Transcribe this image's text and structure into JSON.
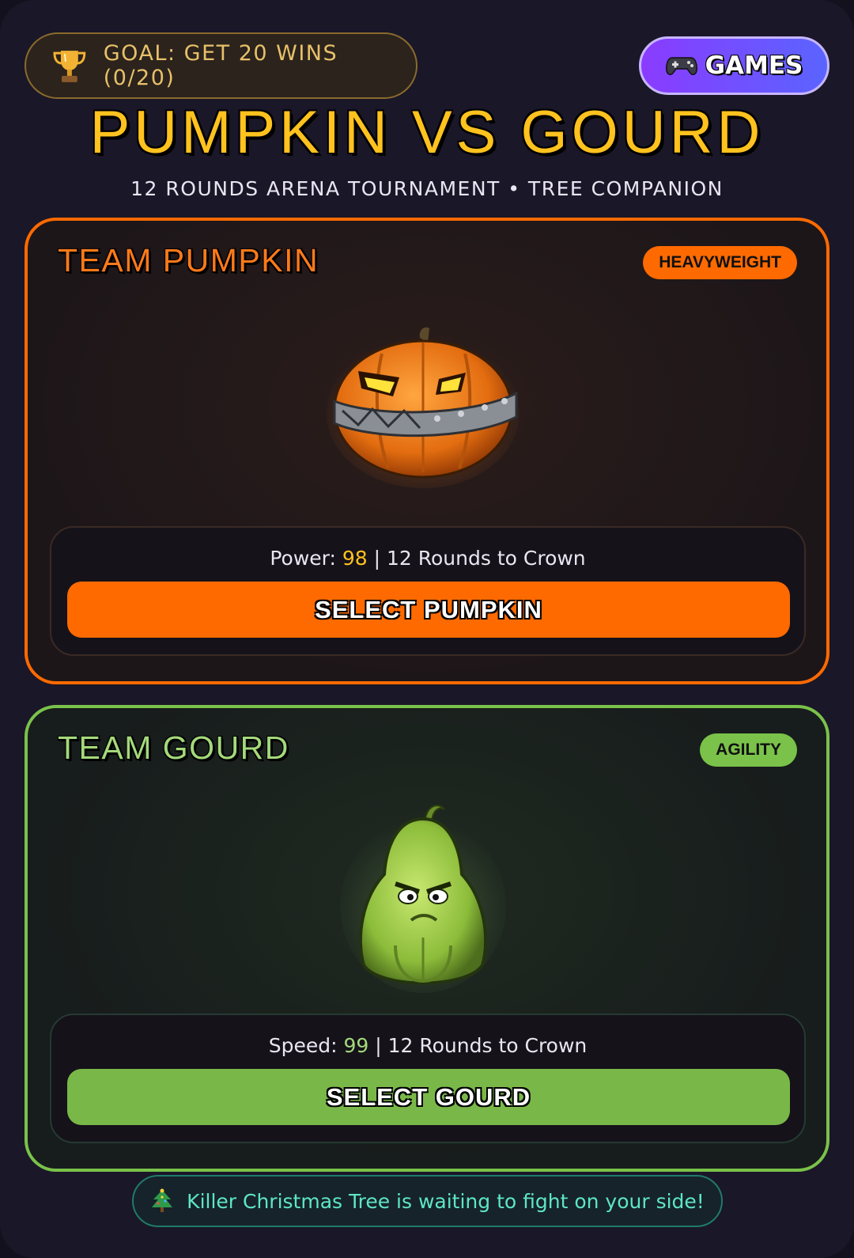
{
  "header": {
    "goal_text": "GOAL: GET 20 WINS (0/20)",
    "goal_icon": "trophy-icon",
    "games_label": "GAMES",
    "games_icon": "gamepad-icon",
    "title": "PUMPKIN VS GOURD",
    "subtitle": "12 ROUNDS ARENA TOURNAMENT • TREE COMPANION"
  },
  "teams": [
    {
      "name": "TEAM PUMPKIN",
      "badge": "HEAVYWEIGHT",
      "stat_label": "Power: ",
      "stat_value": "98",
      "stat_suffix": " | 12 Rounds to Crown",
      "button_label": "SELECT PUMPKIN",
      "accent": "#ff6a00"
    },
    {
      "name": "TEAM GOURD",
      "badge": "AGILITY",
      "stat_label": "Speed: ",
      "stat_value": "99",
      "stat_suffix": " | 12 Rounds to Crown",
      "button_label": "SELECT GOURD",
      "accent": "#7ac24a"
    }
  ],
  "footer": {
    "icon": "christmas-tree-icon",
    "text": "Killer Christmas Tree is waiting to fight on your side!"
  },
  "colors": {
    "background": "#1a1728",
    "title": "#ffc21e",
    "games_gradient": [
      "#8a3bff",
      "#5a64ff"
    ],
    "footer_text": "#5ee6c6"
  }
}
